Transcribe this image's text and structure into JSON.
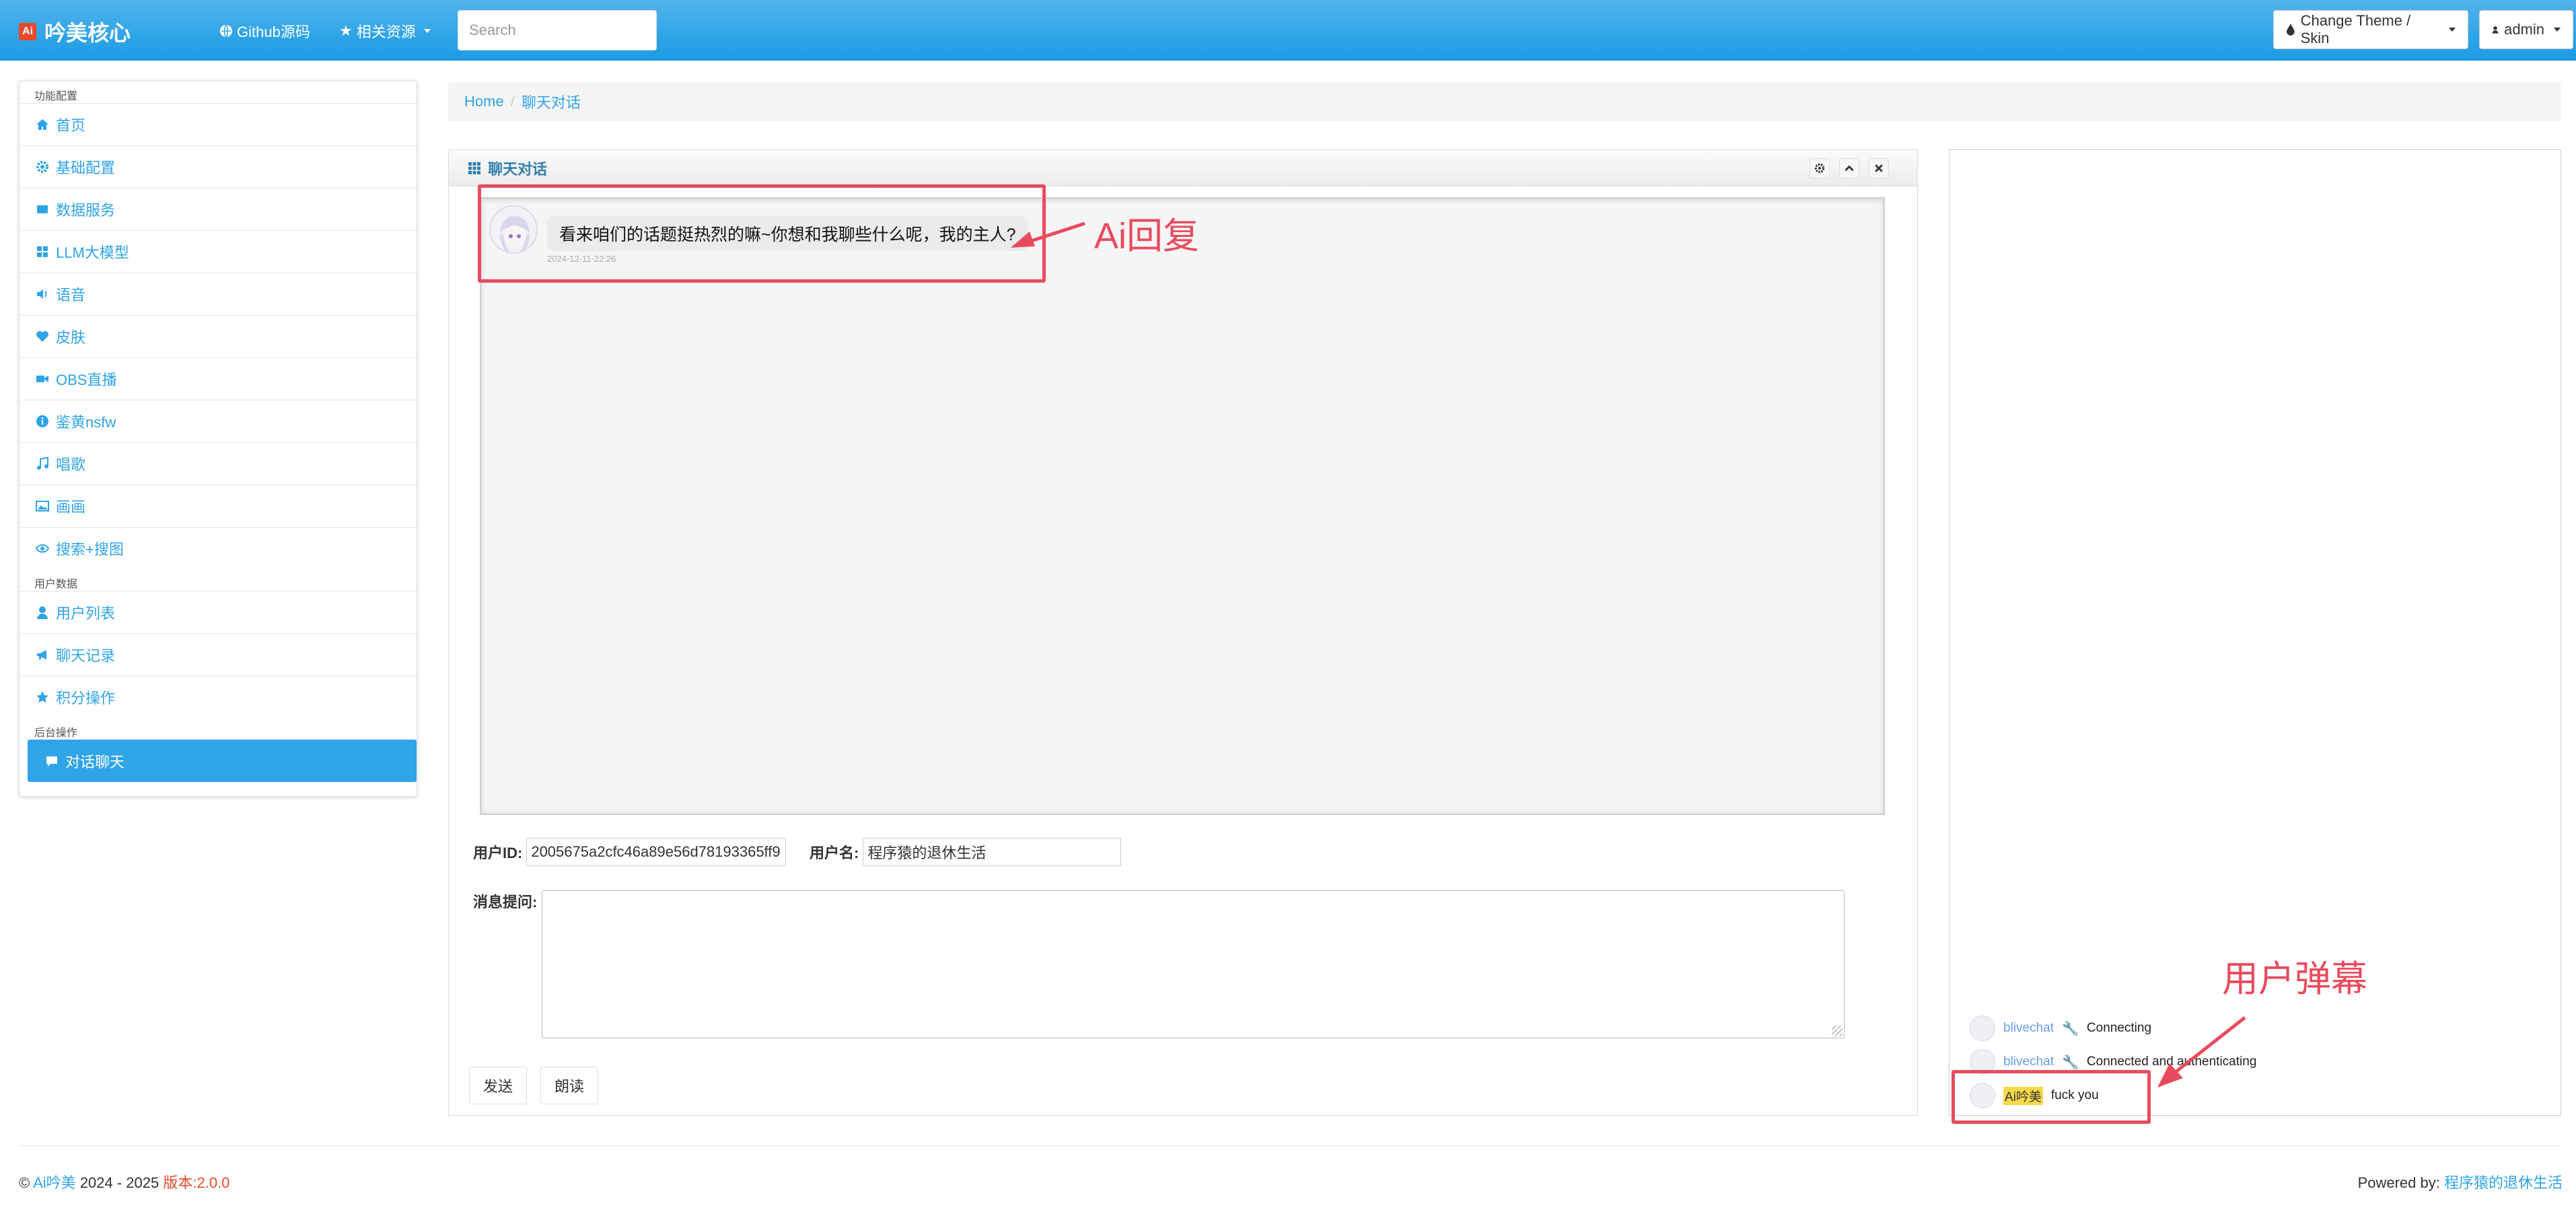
{
  "navbar": {
    "brand_logo": "Ai",
    "brand_title": "吟美核心",
    "github_link": "Github源码",
    "resources_menu": "相关资源",
    "search_placeholder": "Search",
    "theme_button": "Change Theme / Skin",
    "user_button": "admin"
  },
  "sidebar": {
    "section_config": "功能配置",
    "items_config": [
      {
        "label": "首页",
        "icon": "home-icon"
      },
      {
        "label": "基础配置",
        "icon": "gear-icon"
      },
      {
        "label": "数据服务",
        "icon": "hdd-icon"
      },
      {
        "label": "LLM大模型",
        "icon": "grid-icon"
      },
      {
        "label": "语音",
        "icon": "volume-icon"
      },
      {
        "label": "皮肤",
        "icon": "heart-icon"
      },
      {
        "label": "OBS直播",
        "icon": "video-icon"
      },
      {
        "label": "鉴黄nsfw",
        "icon": "info-icon"
      },
      {
        "label": "唱歌",
        "icon": "music-icon"
      },
      {
        "label": "画画",
        "icon": "picture-icon"
      },
      {
        "label": "搜索+搜图",
        "icon": "eye-icon"
      }
    ],
    "section_userdata": "用户数据",
    "items_userdata": [
      {
        "label": "用户列表",
        "icon": "user-icon"
      },
      {
        "label": "聊天记录",
        "icon": "bullhorn-icon"
      },
      {
        "label": "积分操作",
        "icon": "star-icon"
      }
    ],
    "section_backend": "后台操作",
    "items_backend": [
      {
        "label": "对话聊天",
        "icon": "comment-icon",
        "active": true
      }
    ]
  },
  "breadcrumb": {
    "home": "Home",
    "current": "聊天对话"
  },
  "chat_panel": {
    "title": "聊天对话",
    "message_text": "看来咱们的话题挺热烈的嘛~你想和我聊些什么呢，我的主人?",
    "message_time": "2024-12-11-22:26",
    "user_id_label": "用户ID:",
    "user_id_value": "2005675a2cfc46a89e56d78193365ff9",
    "username_label": "用户名:",
    "username_value": "程序猿的退休生活",
    "question_label": "消息提问:",
    "send_button": "发送",
    "read_button": "朗读"
  },
  "danmaku_panel": {
    "rows": [
      {
        "name": "blivechat",
        "text": "Connecting",
        "has_wrench": true,
        "highlight": false
      },
      {
        "name": "blivechat",
        "text": "Connected and authenticating",
        "has_wrench": true,
        "highlight": false
      },
      {
        "name": "Ai吟美",
        "text": "fuck you",
        "has_wrench": false,
        "highlight": true
      }
    ]
  },
  "annotations": {
    "ai_reply": "Ai回复",
    "user_danmaku": "用户弹幕",
    "color": "#e84b5e"
  },
  "footer": {
    "copyright": "©",
    "site_name": "Ai吟美",
    "years": "2024 - 2025",
    "version": "版本:2.0.0",
    "powered_label": "Powered by:",
    "powered_link": "程序猿的退休生活"
  },
  "colors": {
    "accent": "#2fa4e7",
    "navbar": "#2fa4e7",
    "annotation": "#e84b5e",
    "version": "#e8492b"
  }
}
